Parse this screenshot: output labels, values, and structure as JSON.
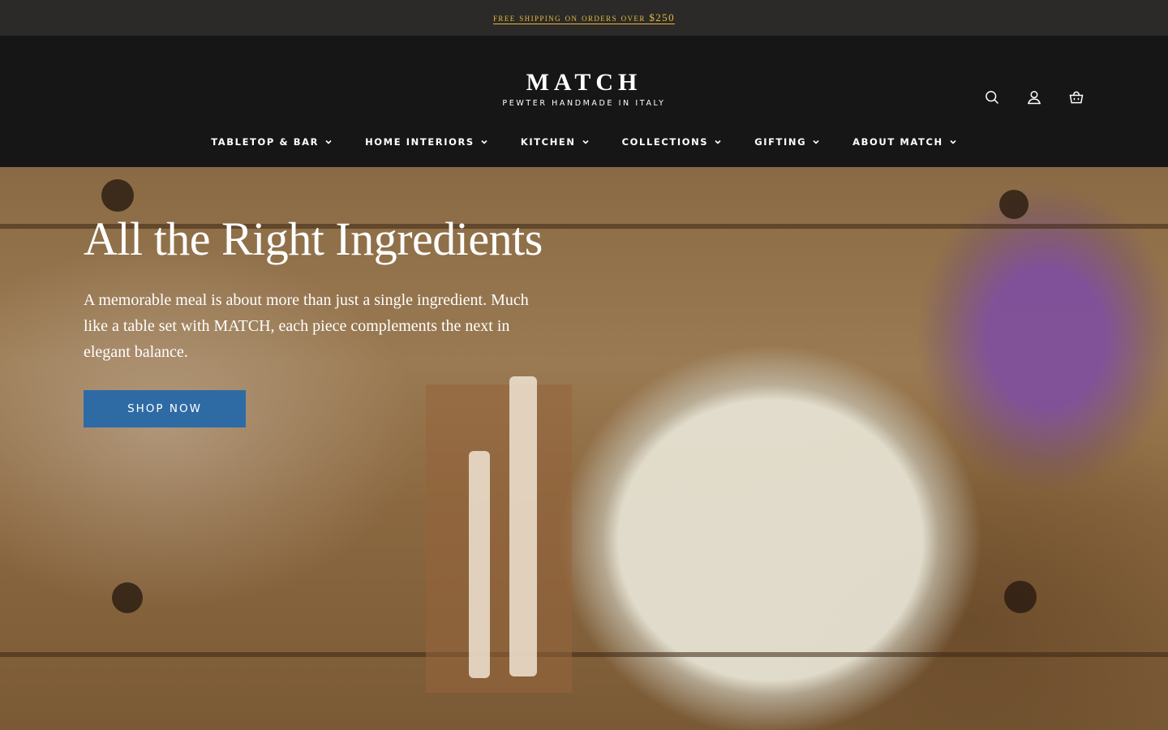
{
  "announcement": {
    "text": "FREE SHIPPING ON ORDERS OVER $250"
  },
  "brand": {
    "name": "MATCH",
    "tagline": "PEWTER HANDMADE IN ITALY"
  },
  "utility": {
    "search_icon": "search-icon",
    "account_icon": "user-icon",
    "cart_icon": "shopping-basket-icon"
  },
  "nav": {
    "items": [
      {
        "label": "TABLETOP & BAR"
      },
      {
        "label": "HOME INTERIORS"
      },
      {
        "label": "KITCHEN"
      },
      {
        "label": "COLLECTIONS"
      },
      {
        "label": "GIFTING"
      },
      {
        "label": "ABOUT MATCH"
      }
    ]
  },
  "hero": {
    "title": "All the Right Ingredients",
    "text": "A memorable meal is about more than just a single ingredient. Much like a table set with MATCH, each piece complements the next in elegant balance.",
    "cta": "SHOP NOW"
  },
  "colors": {
    "announce_bg": "#2b2a28",
    "announce_link": "#e6b93e",
    "header_bg": "#161616",
    "button": "#2e6ba5"
  }
}
